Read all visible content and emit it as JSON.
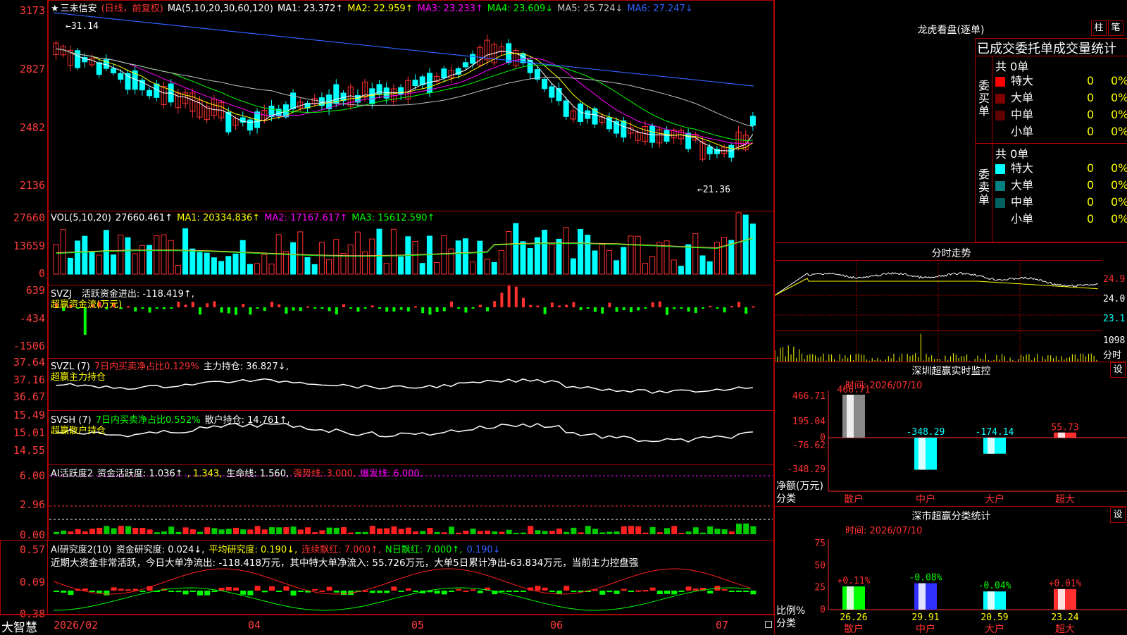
{
  "app": {
    "name": "大智慧"
  },
  "stock": {
    "star": "★",
    "name": "三未信安",
    "period": "(日线，前复权)"
  },
  "main": {
    "y_ticks": [
      "3173",
      "2827",
      "2482",
      "2136"
    ],
    "ma_prefix": "MA(5,10,20,30,60,120)",
    "ma": [
      {
        "label": "MA1: 23.372↑",
        "color": "#ffffff"
      },
      {
        "label": "MA2: 22.959↑",
        "color": "#ffff00"
      },
      {
        "label": "MA3: 23.233↑",
        "color": "#ff00ff"
      },
      {
        "label": "MA4: 23.609↓",
        "color": "#00ff00"
      },
      {
        "label": "MA5: 25.724↓",
        "color": "#c0c0c0"
      },
      {
        "label": "MA6: 27.247↓",
        "color": "#3060ff"
      }
    ],
    "high_label": "31.14",
    "low_label": "21.36",
    "colors": {
      "up": "#ff3030",
      "down": "#00ffff"
    }
  },
  "vol": {
    "y_ticks": [
      "27660",
      "13659",
      "0"
    ],
    "prefix": "VOL(5,10,20)",
    "value": "27660.461↑",
    "ma": [
      {
        "label": "MA1: 20334.836↑",
        "color": "#ffff00"
      },
      {
        "label": "MA2: 17167.617↑",
        "color": "#ff00ff"
      },
      {
        "label": "MA3: 15612.590↑",
        "color": "#00ff00"
      }
    ]
  },
  "svzj": {
    "y_ticks": [
      "639",
      "-434",
      "-1506"
    ],
    "title": "SVZJ",
    "line1": "活跃资金进出: -118.419↑,",
    "line2": "超赢资金流(万元)"
  },
  "svzl": {
    "y_ticks": [
      "37.64",
      "37.16",
      "36.67"
    ],
    "title": "SVZL (7)",
    "ratio": "7日内买卖净占比0.129%",
    "hold": "主力持仓: 36.827↓,",
    "line2": "超赢主力持仓"
  },
  "svsh": {
    "y_ticks": [
      "15.49",
      "15.01",
      "14.55"
    ],
    "title": "SVSH (7)",
    "ratio": "7日内买卖净占比0.552%",
    "hold": "散户持仓: 14.761↑,",
    "line2": "超赢散户持仓"
  },
  "ai_active": {
    "y_ticks": [
      "6.00",
      "2.96",
      "0.00"
    ],
    "title": "AI活跃度2",
    "a": "资金活跃度: 1.036↑",
    "b": ", 1.343,",
    "c": "生命线: 1.560,",
    "d": "强势线: 3.000,",
    "e": "爆发线: 6.000,"
  },
  "ai_research": {
    "y_ticks": [
      "0.57",
      "0.09",
      "-0.38"
    ],
    "title": "AI研究度2(10)",
    "a": "资金研究度: 0.024↓,",
    "b": "平均研究度: 0.190↓,",
    "c": "连续飘红: 7.000↑,",
    "d": "N日飘红: 7.000↑,",
    "e": "0.190↓",
    "summary": "近期大资金非常活跃，今日大单净流出: -118.418万元，其中特大单净流入: 55.726万元，大单5日累计净出-63.834万元，当前主力控盘强"
  },
  "dates": [
    "2026/02",
    "04",
    "05",
    "06",
    "07"
  ],
  "lhb": {
    "title": "龙虎看盘(逐单)",
    "btn1": "柱",
    "btn2": "笔",
    "tabs": "已成交委托单成交量统计",
    "buy_label": "委买单",
    "sell_label": "委卖单",
    "buy_total": "共 0单",
    "sell_total": "共 0单",
    "buy_rows": [
      {
        "name": "特大",
        "count": "0",
        "pct": "0%",
        "color": "#ff0000"
      },
      {
        "name": "大单",
        "count": "0",
        "pct": "0%",
        "color": "#800000"
      },
      {
        "name": "中单",
        "count": "0",
        "pct": "0%",
        "color": "#600000"
      },
      {
        "name": "小单",
        "count": "0",
        "pct": "0%",
        "color": "#000000"
      }
    ],
    "sell_rows": [
      {
        "name": "特大",
        "count": "0",
        "pct": "0%",
        "color": "#00ffff"
      },
      {
        "name": "大单",
        "count": "0",
        "pct": "0%",
        "color": "#008080"
      },
      {
        "name": "中单",
        "count": "0",
        "pct": "0%",
        "color": "#006060"
      },
      {
        "name": "小单",
        "count": "0",
        "pct": "0%",
        "color": "#000000"
      }
    ]
  },
  "intraday": {
    "title": "分时走势",
    "y_labels": [
      "24.9",
      "24.0",
      "23.1"
    ],
    "vol_label": "1098",
    "vol_unit": "分时"
  },
  "realtime": {
    "title": "深圳超赢实时监控",
    "btn": "设",
    "time": "时间: 2026/07/10",
    "y_ticks": [
      "466.71",
      "195.04",
      "0",
      "-76.62",
      "-348.29"
    ],
    "unit1": "净额(万元)",
    "unit2": "分类",
    "categories": [
      "散户",
      "中户",
      "大户",
      "超大"
    ],
    "values": [
      466.71,
      -348.29,
      -174.14,
      55.73
    ],
    "value_labels": [
      "466.71",
      "-348.29",
      "-174.14",
      "55.73"
    ]
  },
  "classstat": {
    "title": "深市超赢分类统计",
    "btn": "设",
    "time": "时间: 2026/07/10",
    "y_ticks": [
      "75",
      "50",
      "25",
      "0"
    ],
    "unit1": "比例%",
    "unit2": "分类",
    "categories": [
      "散户",
      "中户",
      "大户",
      "超大"
    ],
    "values": [
      26.26,
      29.91,
      20.59,
      23.24
    ],
    "changes": [
      "+0.11%",
      "-0.08%",
      "-0.04%",
      "+0.01%"
    ]
  }
}
